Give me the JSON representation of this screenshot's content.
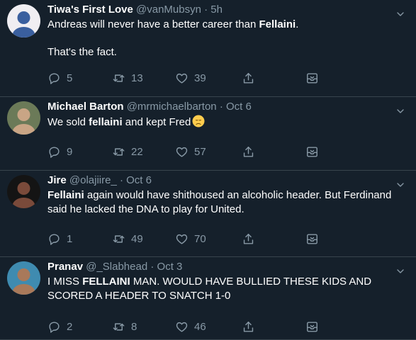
{
  "tweets": [
    {
      "name": "Tiwa's First Love",
      "handle": "@vanMubsyn",
      "sep": "·",
      "time": "5h",
      "segments": [
        [
          {
            "t": "Andreas will never have a better career than "
          },
          {
            "t": "Fellaini",
            "b": true
          },
          {
            "t": "."
          }
        ],
        [
          {
            "t": "That's the fact."
          }
        ]
      ],
      "replies": "5",
      "retweets": "13",
      "likes": "39",
      "avatar_bg": "#f0eef2",
      "avatar_fg": "#3a5f9e"
    },
    {
      "name": "Michael Barton",
      "handle": "@mrmichaelbarton",
      "sep": "·",
      "time": "Oct 6",
      "segments": [
        [
          {
            "t": "We sold "
          },
          {
            "t": "fellaini",
            "b": true
          },
          {
            "t": " and kept Fred"
          }
        ]
      ],
      "emoji": "disappointed-face",
      "replies": "9",
      "retweets": "22",
      "likes": "57",
      "avatar_bg": "#6b7a58",
      "avatar_fg": "#c9a585"
    },
    {
      "name": "Jire",
      "handle": "@olajiire_",
      "sep": "·",
      "time": "Oct 6",
      "segments": [
        [
          {
            "t": "Fellaini",
            "b": true
          },
          {
            "t": " again would have shithoused an alcoholic header. But Ferdinand said he lacked the DNA to play for United."
          }
        ]
      ],
      "replies": "1",
      "retweets": "49",
      "likes": "70",
      "avatar_bg": "#141414",
      "avatar_fg": "#7a4a3a"
    },
    {
      "name": "Pranav",
      "handle": "@_Slabhead",
      "sep": "·",
      "time": "Oct 3",
      "segments": [
        [
          {
            "t": "I MISS "
          },
          {
            "t": "FELLAINI",
            "b": true
          },
          {
            "t": " MAN. WOULD HAVE BULLIED THESE KIDS AND SCORED A HEADER TO SNATCH 1-0"
          }
        ]
      ],
      "replies": "2",
      "retweets": "8",
      "likes": "46",
      "avatar_bg": "#3f8bb0",
      "avatar_fg": "#a9795a"
    }
  ],
  "colors": {
    "background": "#15202b",
    "divider": "#38444d",
    "secondary_text": "#8899a6",
    "primary_text": "#ffffff"
  },
  "icons": [
    "reply-icon",
    "retweet-icon",
    "like-icon",
    "share-icon",
    "caret-icon"
  ]
}
